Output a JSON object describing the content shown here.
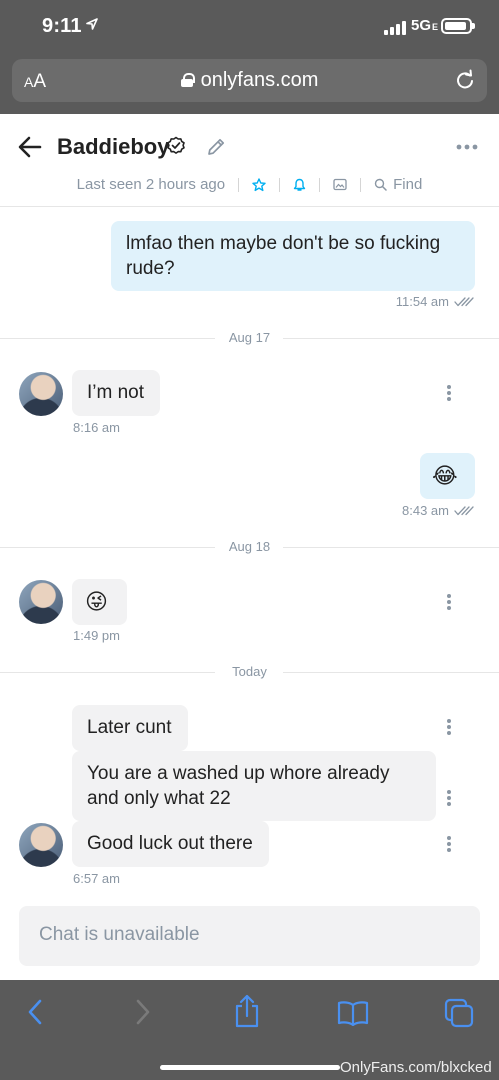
{
  "status_bar": {
    "time": "9:11",
    "network": "5G",
    "network_sub": "E"
  },
  "browser": {
    "aa_small": "A",
    "aa_large": "A",
    "domain": "onlyfans.com"
  },
  "chat": {
    "contact_name": "Baddieboy",
    "last_seen": "Last seen 2 hours ago",
    "find_label": "Find"
  },
  "messages": {
    "m1": {
      "text": "lmfao then maybe don't be so fucking rude?",
      "time": "11:54 am"
    },
    "d1": "Aug 17",
    "m2": {
      "text": "I’m not",
      "time": "8:16 am"
    },
    "m3": {
      "text": "😂",
      "time": "8:43 am"
    },
    "d2": "Aug 18",
    "m4": {
      "text": "😜",
      "time": "1:49 pm"
    },
    "d3": "Today",
    "m5": {
      "text": "Later cunt"
    },
    "m6": {
      "text": "You are a washed up whore already and only what 22"
    },
    "m7": {
      "text": "Good luck out there",
      "time": "6:57 am"
    }
  },
  "composer": {
    "placeholder": "Chat is unavailable"
  },
  "watermark": "OnlyFans.com/blxcked",
  "colors": {
    "accent": "#00aff0",
    "outgoing_bubble": "#e0f2fb",
    "incoming_bubble": "#f2f2f3",
    "muted_text": "#8a96a3",
    "ios_blue": "#4a90f0"
  }
}
